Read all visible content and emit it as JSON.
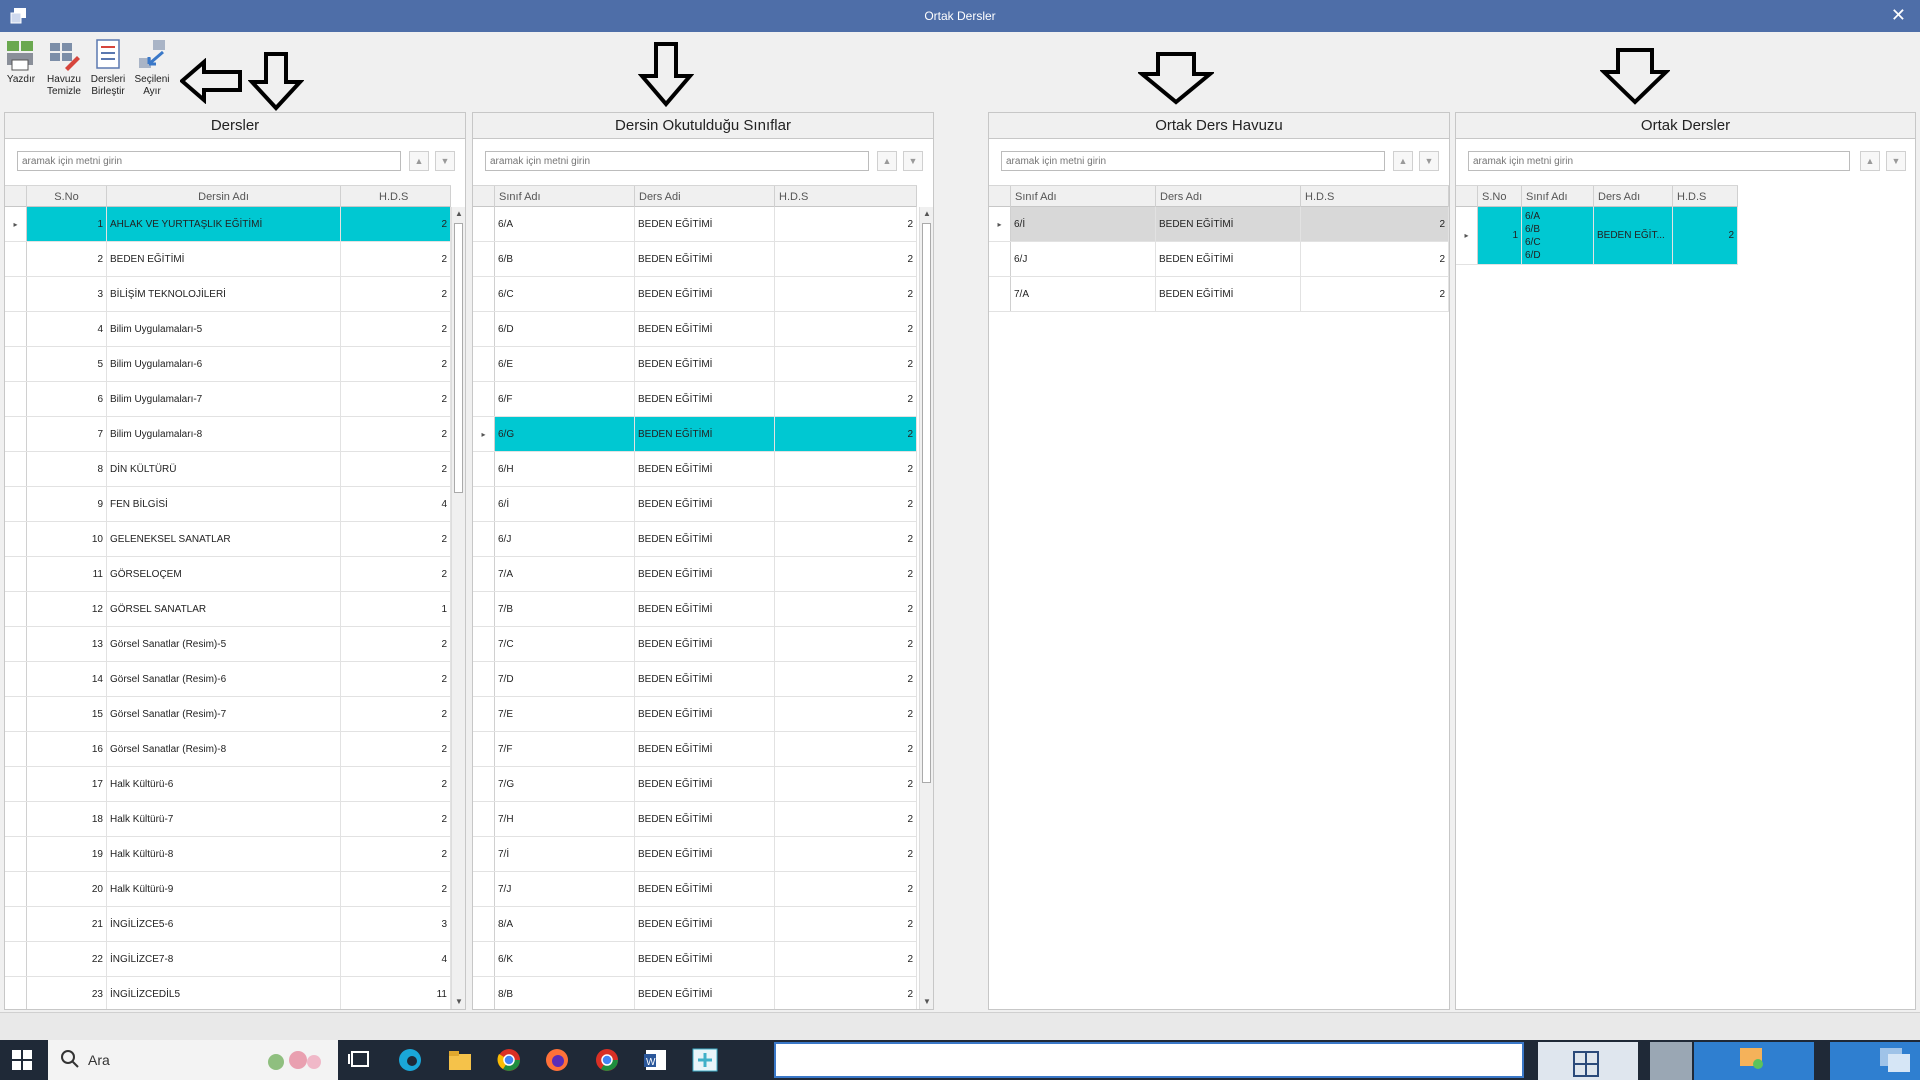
{
  "window": {
    "title": "Ortak Dersler",
    "close_glyph": "✕"
  },
  "toolbar": {
    "buttons": [
      {
        "label1": "Yazdır",
        "label2": "",
        "icon": "print-icon"
      },
      {
        "label1": "Havuzu",
        "label2": "Temizle",
        "icon": "clear-pool-icon"
      },
      {
        "label1": "Dersleri",
        "label2": "Birleştir",
        "icon": "merge-icon"
      },
      {
        "label1": "Seçileni",
        "label2": "Ayır",
        "icon": "split-icon"
      }
    ]
  },
  "search_placeholder": "aramak için metni girin",
  "panels": {
    "dersler": {
      "title": "Dersler",
      "columns": [
        "S.No",
        "Dersin Adı",
        "H.D.S"
      ],
      "rows": [
        [
          "1",
          "AHLAK VE YURTTAŞLIK EĞİTİMİ",
          "2"
        ],
        [
          "2",
          "BEDEN EĞİTİMİ",
          "2"
        ],
        [
          "3",
          "BİLİŞİM TEKNOLOJİLERİ",
          "2"
        ],
        [
          "4",
          "Bilim Uygulamaları-5",
          "2"
        ],
        [
          "5",
          "Bilim Uygulamaları-6",
          "2"
        ],
        [
          "6",
          "Bilim Uygulamaları-7",
          "2"
        ],
        [
          "7",
          "Bilim Uygulamaları-8",
          "2"
        ],
        [
          "8",
          "DİN KÜLTÜRÜ",
          "2"
        ],
        [
          "9",
          "FEN BİLGİSİ",
          "4"
        ],
        [
          "10",
          "GELENEKSEL SANATLAR",
          "2"
        ],
        [
          "11",
          "GÖRSELOÇEM",
          "2"
        ],
        [
          "12",
          "GÖRSEL SANATLAR",
          "1"
        ],
        [
          "13",
          "Görsel Sanatlar (Resim)-5",
          "2"
        ],
        [
          "14",
          "Görsel Sanatlar (Resim)-6",
          "2"
        ],
        [
          "15",
          "Görsel Sanatlar (Resim)-7",
          "2"
        ],
        [
          "16",
          "Görsel Sanatlar (Resim)-8",
          "2"
        ],
        [
          "17",
          "Halk Kültürü-6",
          "2"
        ],
        [
          "18",
          "Halk Kültürü-7",
          "2"
        ],
        [
          "19",
          "Halk Kültürü-8",
          "2"
        ],
        [
          "20",
          "Halk Kültürü-9",
          "2"
        ],
        [
          "21",
          "İNGİLİZCE5-6",
          "3"
        ],
        [
          "22",
          "İNGİLİZCE7-8",
          "4"
        ],
        [
          "23",
          "İNGİLİZCEDİL5",
          "11"
        ]
      ]
    },
    "siniflar": {
      "title": "Dersin Okutulduğu Sınıflar",
      "columns": [
        "Sınıf Adı",
        "Ders Adi",
        "H.D.S"
      ],
      "rows": [
        [
          "6/A",
          "BEDEN EĞİTİMİ",
          "2"
        ],
        [
          "6/B",
          "BEDEN EĞİTİMİ",
          "2"
        ],
        [
          "6/C",
          "BEDEN EĞİTİMİ",
          "2"
        ],
        [
          "6/D",
          "BEDEN EĞİTİMİ",
          "2"
        ],
        [
          "6/E",
          "BEDEN EĞİTİMİ",
          "2"
        ],
        [
          "6/F",
          "BEDEN EĞİTİMİ",
          "2"
        ],
        [
          "6/G",
          "BEDEN EĞİTİMİ",
          "2"
        ],
        [
          "6/H",
          "BEDEN EĞİTİMİ",
          "2"
        ],
        [
          "6/İ",
          "BEDEN EĞİTİMİ",
          "2"
        ],
        [
          "6/J",
          "BEDEN EĞİTİMİ",
          "2"
        ],
        [
          "7/A",
          "BEDEN EĞİTİMİ",
          "2"
        ],
        [
          "7/B",
          "BEDEN EĞİTİMİ",
          "2"
        ],
        [
          "7/C",
          "BEDEN EĞİTİMİ",
          "2"
        ],
        [
          "7/D",
          "BEDEN EĞİTİMİ",
          "2"
        ],
        [
          "7/E",
          "BEDEN EĞİTİMİ",
          "2"
        ],
        [
          "7/F",
          "BEDEN EĞİTİMİ",
          "2"
        ],
        [
          "7/G",
          "BEDEN EĞİTİMİ",
          "2"
        ],
        [
          "7/H",
          "BEDEN EĞİTİMİ",
          "2"
        ],
        [
          "7/İ",
          "BEDEN EĞİTİMİ",
          "2"
        ],
        [
          "7/J",
          "BEDEN EĞİTİMİ",
          "2"
        ],
        [
          "8/A",
          "BEDEN EĞİTİMİ",
          "2"
        ],
        [
          "6/K",
          "BEDEN EĞİTİMİ",
          "2"
        ],
        [
          "8/B",
          "BEDEN EĞİTİMİ",
          "2"
        ]
      ]
    },
    "havuz": {
      "title": "Ortak Ders Havuzu",
      "columns": [
        "Sınıf Adı",
        "Ders Adı",
        "H.D.S"
      ],
      "rows": [
        [
          "6/İ",
          "BEDEN EĞİTİMİ",
          "2"
        ],
        [
          "6/J",
          "BEDEN EĞİTİMİ",
          "2"
        ],
        [
          "7/A",
          "BEDEN EĞİTİMİ",
          "2"
        ]
      ]
    },
    "ortak": {
      "title": "Ortak Dersler",
      "columns": [
        "S.No",
        "Sınıf Adı",
        "Ders Adı",
        "H.D.S"
      ],
      "rows": [
        {
          "sno": "1",
          "classes": [
            "6/A",
            "6/B",
            "6/C",
            "6/D"
          ],
          "ders": "BEDEN EĞİT...",
          "hds": "2"
        }
      ]
    }
  },
  "taskbar": {
    "search_label": "Ara"
  },
  "colors": {
    "selection": "#00c8d2",
    "titlebar": "#4e6ea8"
  }
}
